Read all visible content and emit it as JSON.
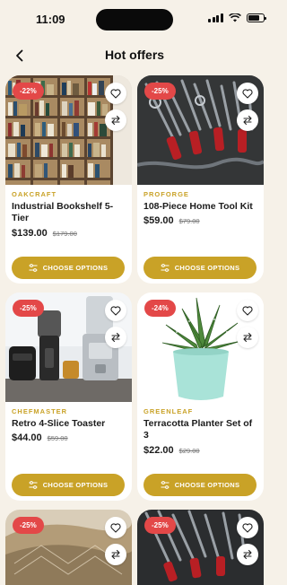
{
  "status_bar": {
    "time": "11:09"
  },
  "header": {
    "title": "Hot offers"
  },
  "colors": {
    "accent": "#c9a227",
    "badge": "#e34848",
    "background": "#f6f1e8"
  },
  "products": [
    {
      "brand": "OAKCRAFT",
      "name": "Industrial Bookshelf 5-Tier",
      "price": "$139.00",
      "old_price": "$179.00",
      "discount": "-22%",
      "action": "CHOOSE OPTIONS",
      "image": "bookshelf-photo"
    },
    {
      "brand": "PROFORGE",
      "name": "108-Piece Home Tool Kit",
      "price": "$59.00",
      "old_price": "$79.00",
      "discount": "-25%",
      "action": "CHOOSE OPTIONS",
      "image": "tools-photo"
    },
    {
      "brand": "CHEFMASTER",
      "name": "Retro 4-Slice Toaster",
      "price": "$44.00",
      "old_price": "$59.00",
      "discount": "-25%",
      "action": "CHOOSE OPTIONS",
      "image": "kitchen-appliances-photo"
    },
    {
      "brand": "GREENLEAF",
      "name": "Terracotta Planter Set of 3",
      "price": "$22.00",
      "old_price": "$29.00",
      "discount": "-24%",
      "action": "CHOOSE OPTIONS",
      "image": "succulent-planter-photo"
    },
    {
      "discount": "-25%",
      "image": "rug-photo"
    },
    {
      "discount": "-25%",
      "image": "tools-photo"
    }
  ]
}
